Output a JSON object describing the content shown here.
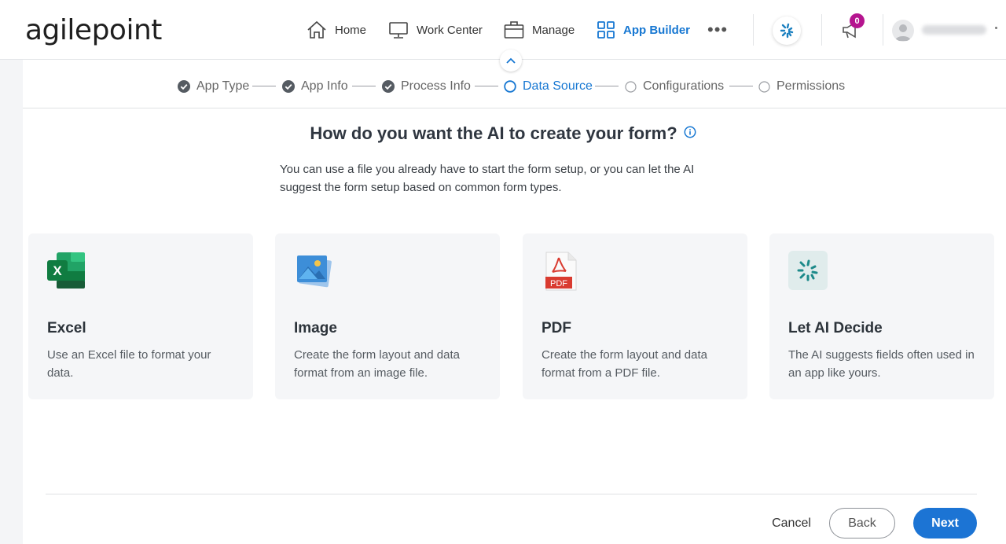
{
  "brand": {
    "logo_text": "agilepoint"
  },
  "nav": {
    "home": "Home",
    "work_center": "Work Center",
    "manage": "Manage",
    "app_builder": "App Builder",
    "notification_count": "0",
    "accent_color": "#1677d2"
  },
  "stepper": {
    "steps": [
      {
        "label": "App Type",
        "status": "complete"
      },
      {
        "label": "App Info",
        "status": "complete"
      },
      {
        "label": "Process Info",
        "status": "complete"
      },
      {
        "label": "Data Source",
        "status": "current"
      },
      {
        "label": "Configurations",
        "status": "pending"
      },
      {
        "label": "Permissions",
        "status": "pending"
      }
    ]
  },
  "main": {
    "question": "How do you want the AI to create your form?",
    "description": "You can use a file you already have to start the form setup, or you can let the AI suggest the form setup based on common form types.",
    "options": [
      {
        "title": "Excel",
        "text": "Use an Excel file to format your data.",
        "icon": "excel-icon"
      },
      {
        "title": "Image",
        "text": "Create the form layout and data format from an image file.",
        "icon": "image-icon"
      },
      {
        "title": "PDF",
        "text": "Create the form layout and data format from a PDF file.",
        "icon": "pdf-icon"
      },
      {
        "title": "Let AI Decide",
        "text": "The AI suggests fields often used in an app like yours.",
        "icon": "ai-icon"
      }
    ],
    "pdf_icon_label": "PDF",
    "excel_icon_letter": "X"
  },
  "footer": {
    "cancel": "Cancel",
    "back": "Back",
    "next": "Next"
  }
}
